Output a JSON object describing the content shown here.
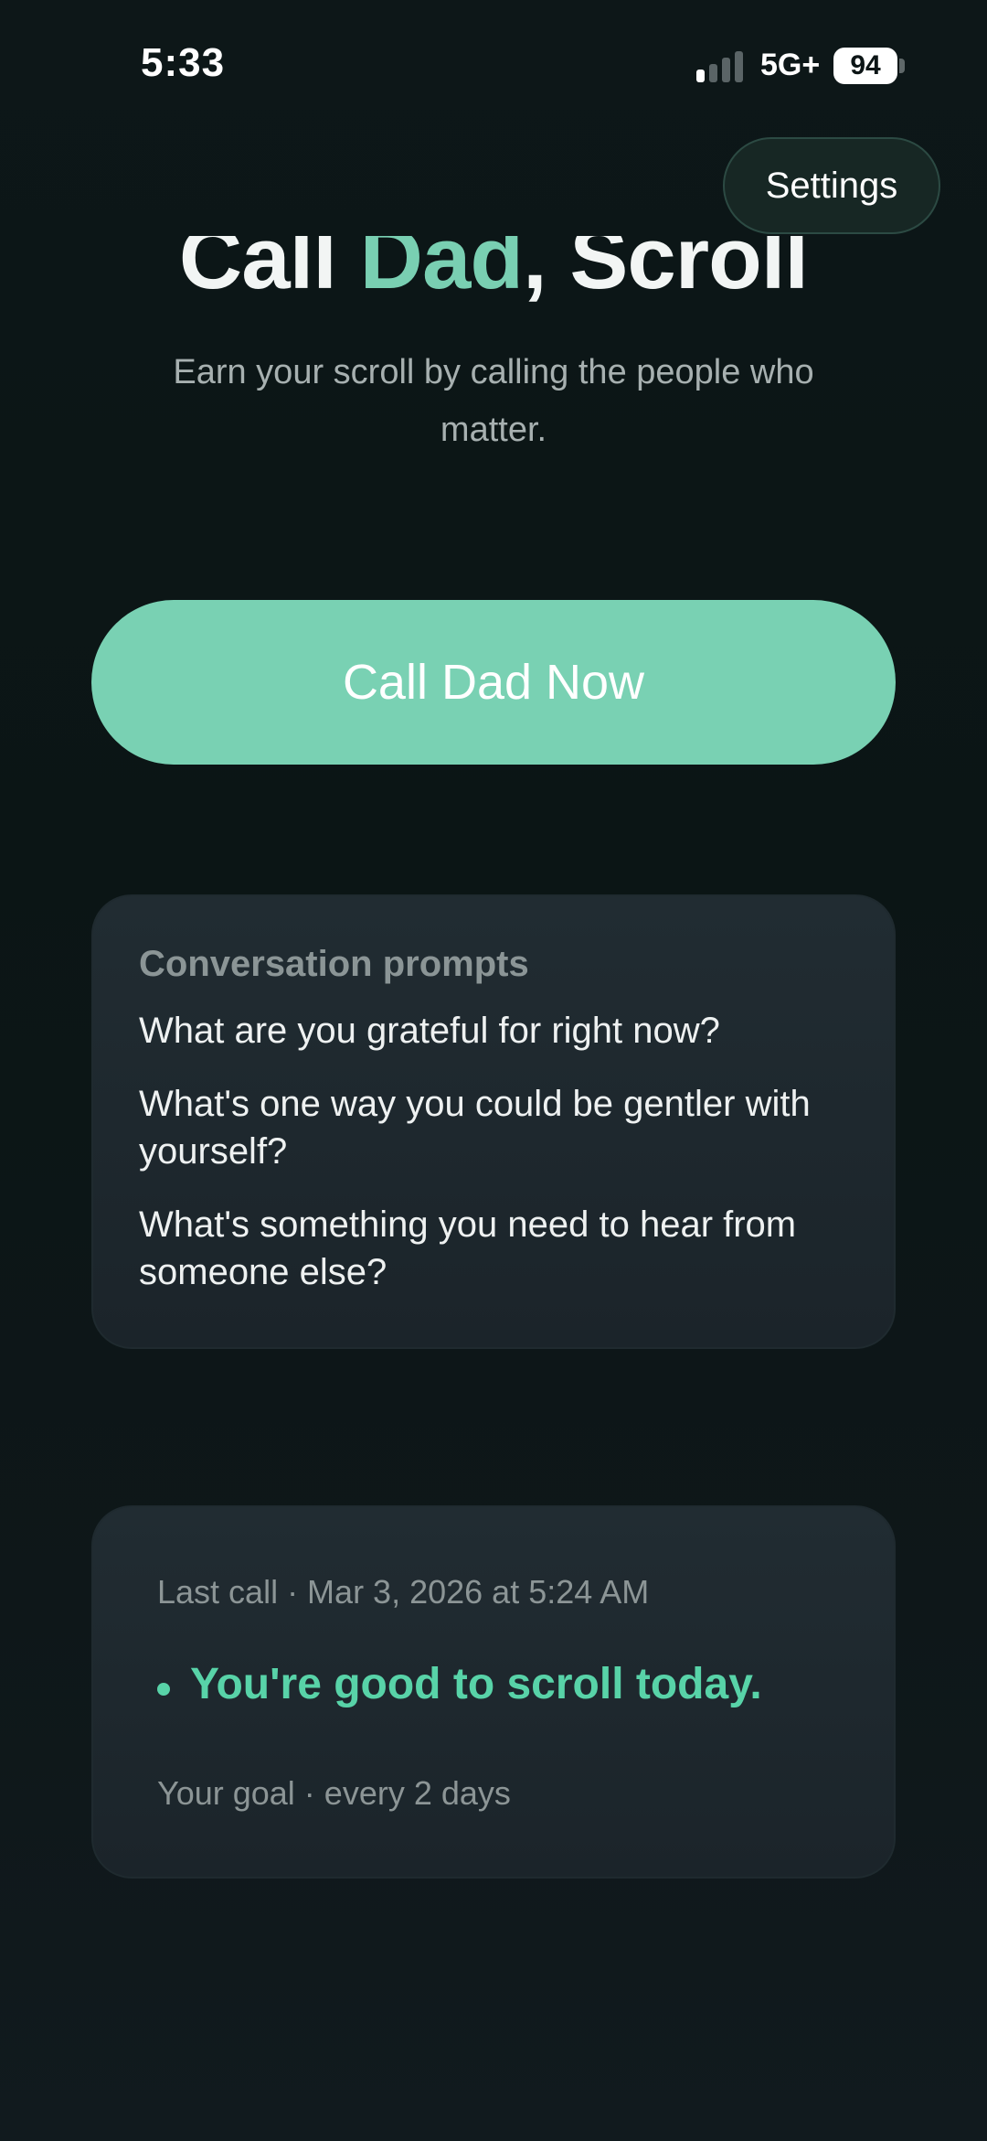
{
  "status_bar": {
    "time": "5:33",
    "network": "5G+",
    "battery": "94"
  },
  "settings": {
    "label": "Settings"
  },
  "header": {
    "title_part1": "Call ",
    "title_accent": "Dad",
    "title_part2": ", Scroll",
    "subtitle": "Earn your scroll by calling the people who matter."
  },
  "cta": {
    "label": "Call Dad Now"
  },
  "prompts": {
    "heading": "Conversation prompts",
    "items": [
      "What are you grateful for right now?",
      "What's one way you could be gentler with yourself?",
      "What's something you need to hear from someone else?"
    ]
  },
  "status": {
    "last_call": "Last call · Mar 3, 2026 at 5:24 AM",
    "message": "You're good to scroll today.",
    "goal": "Your goal · every 2 days"
  },
  "colors": {
    "accent": "#79d1b3",
    "status_green": "#58d3a8",
    "background": "#0b1515"
  },
  "icons": [
    "signal-icon",
    "battery-icon",
    "status-dot-icon"
  ]
}
